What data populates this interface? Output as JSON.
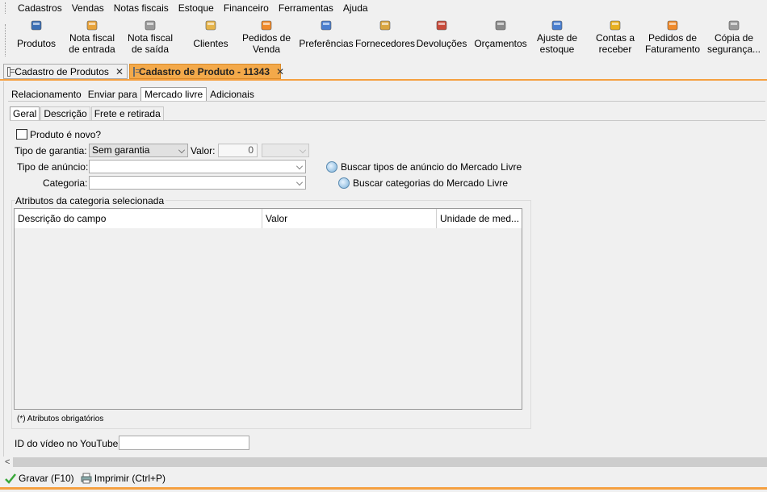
{
  "menu": [
    "Cadastros",
    "Vendas",
    "Notas fiscais",
    "Estoque",
    "Financeiro",
    "Ferramentas",
    "Ajuda"
  ],
  "toolbar": [
    {
      "id": "produtos",
      "l1": "Produtos",
      "l2": "",
      "icon": "box-icon",
      "color": "#3b6fb5"
    },
    {
      "id": "nf-entrada",
      "l1": "Nota fiscal",
      "l2": "de entrada",
      "icon": "invoice-in-icon",
      "color": "#e8a33a"
    },
    {
      "id": "nf-saida",
      "l1": "Nota fiscal",
      "l2": "de saída",
      "icon": "invoice-out-icon",
      "color": "#9a9a9a"
    },
    {
      "id": "clientes",
      "l1": "Clientes",
      "l2": "",
      "icon": "person-icon",
      "color": "#e6b44a"
    },
    {
      "id": "pedidos-venda",
      "l1": "Pedidos de",
      "l2": "Venda",
      "icon": "cart-icon",
      "color": "#f08a2a"
    },
    {
      "id": "preferencias",
      "l1": "Preferências",
      "l2": "",
      "icon": "settings-icon",
      "color": "#4a7fd0"
    },
    {
      "id": "fornecedores",
      "l1": "Fornecedores",
      "l2": "",
      "icon": "supplier-icon",
      "color": "#d9a540"
    },
    {
      "id": "devolucoes",
      "l1": "Devoluções",
      "l2": "",
      "icon": "return-icon",
      "color": "#c84a3a"
    },
    {
      "id": "orcamentos",
      "l1": "Orçamentos",
      "l2": "",
      "icon": "quote-icon",
      "color": "#8a8a8a"
    },
    {
      "id": "ajuste-estoque",
      "l1": "Ajuste de",
      "l2": "estoque",
      "icon": "stock-icon",
      "color": "#4a7fd0"
    },
    {
      "id": "contas-receber",
      "l1": "Contas a",
      "l2": "receber",
      "icon": "coins-icon",
      "color": "#e8b020"
    },
    {
      "id": "pedidos-faturamento",
      "l1": "Pedidos de",
      "l2": "Faturamento",
      "icon": "billing-icon",
      "color": "#f08a2a"
    },
    {
      "id": "copia-seguranca",
      "l1": "Cópia de",
      "l2": "segurança...",
      "icon": "backup-icon",
      "color": "#9a9a9a"
    }
  ],
  "doc_tabs": [
    {
      "label": "Cadastro de Produtos",
      "close": "✕"
    },
    {
      "label": "Cadastro de Produto - 11343",
      "close": "✕"
    }
  ],
  "section_tabs": [
    "Relacionamento",
    "Enviar para",
    "Mercado livre",
    "Adicionais"
  ],
  "inner_tabs": [
    "Geral",
    "Descrição",
    "Frete e retirada"
  ],
  "form": {
    "produto_novo_label": "Produto é novo?",
    "garantia_label": "Tipo de garantia:",
    "garantia_value": "Sem garantia",
    "valor_label": "Valor:",
    "valor_value": "0",
    "anuncio_label": "Tipo de anúncio:",
    "categoria_label": "Categoria:",
    "buscar_anuncio": "Buscar tipos de anúncio do Mercado Livre",
    "buscar_categorias": "Buscar categorias do Mercado Livre",
    "atributos_title": "Atributos da categoria selecionada",
    "col_descricao": "Descrição do campo",
    "col_valor": "Valor",
    "col_unidade": "Unidade de med...",
    "obrigatorios": "(*) Atributos obrigatórios",
    "youtube_label": "ID do vídeo no YouTube:"
  },
  "status": {
    "gravar": "Gravar (F10)",
    "imprimir": "Imprimir (Ctrl+P)"
  },
  "scroll_left": "<"
}
